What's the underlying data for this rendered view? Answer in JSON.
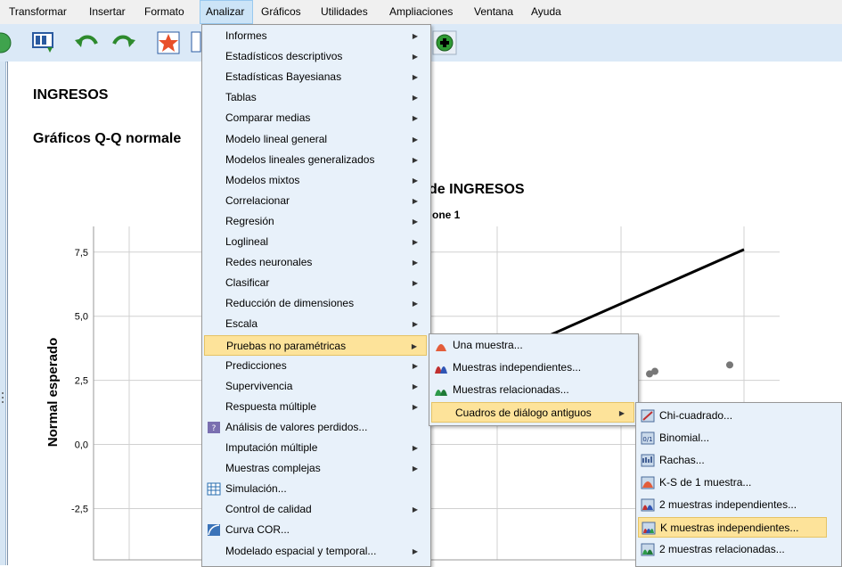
{
  "menubar": {
    "items": [
      {
        "label": "Transformar"
      },
      {
        "label": "Insertar"
      },
      {
        "label": "Formato"
      },
      {
        "label": "Analizar"
      },
      {
        "label": "Gráficos"
      },
      {
        "label": "Utilidades"
      },
      {
        "label": "Ampliaciones"
      },
      {
        "label": "Ventana"
      },
      {
        "label": "Ayuda"
      }
    ]
  },
  "output": {
    "heading": "INGRESOS",
    "subheading": "Gráficos Q-Q normale",
    "chart_title": "de INGRESOS",
    "chart_subtitle": "one 1",
    "ylabel": "Normal esperado"
  },
  "chart_data": {
    "type": "scatter",
    "title": "de INGRESOS",
    "subtitle": "one 1",
    "ylabel": "Normal esperado",
    "y_ticks": [
      "7,5",
      "5,0",
      "2,5",
      "0,0",
      "-2,5"
    ],
    "ylim": [
      -4.5,
      8.5
    ],
    "grid": true,
    "reference_line": {
      "y_start": 4.0,
      "y_end": 7.6
    },
    "points": [
      {
        "y": 2.75
      },
      {
        "y": 2.85
      },
      {
        "y": 3.1
      }
    ]
  },
  "menu_analizar": {
    "items": [
      {
        "label": "Informes",
        "submenu": true
      },
      {
        "label": "Estadísticos descriptivos",
        "submenu": true
      },
      {
        "label": "Estadísticas Bayesianas",
        "submenu": true
      },
      {
        "label": "Tablas",
        "submenu": true
      },
      {
        "label": "Comparar medias",
        "submenu": true
      },
      {
        "label": "Modelo lineal general",
        "submenu": true
      },
      {
        "label": "Modelos lineales generalizados",
        "submenu": true
      },
      {
        "label": "Modelos mixtos",
        "submenu": true
      },
      {
        "label": "Correlacionar",
        "submenu": true
      },
      {
        "label": "Regresión",
        "submenu": true
      },
      {
        "label": "Loglineal",
        "submenu": true
      },
      {
        "label": "Redes neuronales",
        "submenu": true
      },
      {
        "label": "Clasificar",
        "submenu": true
      },
      {
        "label": "Reducción de dimensiones",
        "submenu": true
      },
      {
        "label": "Escala",
        "submenu": true
      },
      {
        "label": "Pruebas no paramétricas",
        "submenu": true
      },
      {
        "label": "Predicciones",
        "submenu": true
      },
      {
        "label": "Supervivencia",
        "submenu": true
      },
      {
        "label": "Respuesta múltiple",
        "submenu": true
      },
      {
        "label": "Análisis de valores perdidos...",
        "submenu": false,
        "icon": "missing-values-icon"
      },
      {
        "label": "Imputación múltiple",
        "submenu": true
      },
      {
        "label": "Muestras complejas",
        "submenu": true
      },
      {
        "label": "Simulación...",
        "submenu": false,
        "icon": "simulation-icon"
      },
      {
        "label": "Control de calidad",
        "submenu": true
      },
      {
        "label": "Curva COR...",
        "submenu": false,
        "icon": "roc-curve-icon"
      },
      {
        "label": "Modelado espacial y temporal...",
        "submenu": true
      }
    ]
  },
  "menu_noparam": {
    "items": [
      {
        "label": "Una muestra...",
        "icon": "one-sample-icon"
      },
      {
        "label": "Muestras independientes...",
        "icon": "independent-samples-icon"
      },
      {
        "label": "Muestras relacionadas...",
        "icon": "related-samples-icon"
      },
      {
        "label": "Cuadros de diálogo antiguos",
        "submenu": true
      }
    ]
  },
  "menu_legacy": {
    "items": [
      {
        "label": "Chi-cuadrado...",
        "icon": "chi-square-icon"
      },
      {
        "label": "Binomial...",
        "icon": "binomial-icon"
      },
      {
        "label": "Rachas...",
        "icon": "runs-icon"
      },
      {
        "label": "K-S de 1 muestra...",
        "icon": "ks-icon"
      },
      {
        "label": "2 muestras independientes...",
        "icon": "two-independent-icon"
      },
      {
        "label": "K muestras independientes...",
        "icon": "k-independent-icon"
      },
      {
        "label": "2 muestras relacionadas...",
        "icon": "two-related-icon"
      }
    ]
  },
  "colors": {
    "highlight": "#fde39a",
    "menu_bg": "#e8f1fa",
    "toolbar_bg": "#dbe9f7"
  }
}
